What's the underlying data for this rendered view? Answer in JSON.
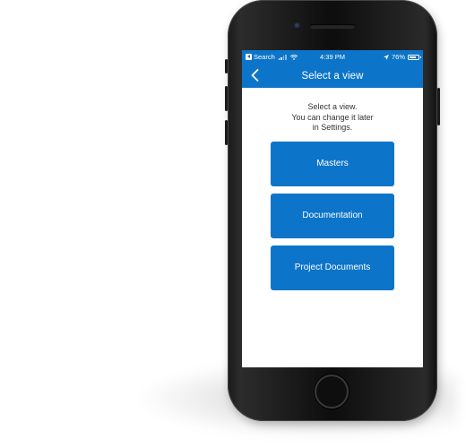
{
  "colors": {
    "accent": "#0c74c9",
    "screen_background": "#ffffff",
    "prompt_text": "#333333"
  },
  "status_bar": {
    "back_app_label": "Search",
    "time": "4:39 PM",
    "battery_text": "76%",
    "battery_level": 0.76,
    "icons": [
      "back-to-app-icon",
      "cellular-signal-icon",
      "wifi-icon",
      "location-arrow-icon",
      "battery-icon"
    ]
  },
  "nav": {
    "title": "Select a view",
    "back_icon": "chevron-left-icon"
  },
  "prompt": {
    "line1": "Select a view.",
    "line2": "You can change it later",
    "line3": "in Settings."
  },
  "views": [
    {
      "label": "Masters"
    },
    {
      "label": "Documentation"
    },
    {
      "label": "Project Documents"
    }
  ]
}
